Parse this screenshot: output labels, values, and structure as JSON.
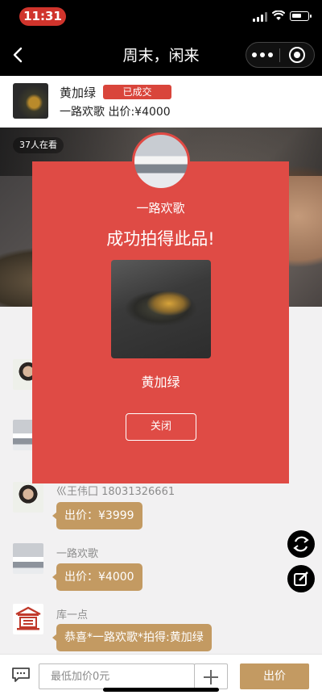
{
  "status_bar": {
    "time": "11:31"
  },
  "nav": {
    "title": "周末，闲来"
  },
  "product": {
    "name": "黄加绿",
    "status": "已成交",
    "buyer_price": "一路欢歌 出价:¥4000"
  },
  "live": {
    "viewers": "37人在看"
  },
  "chat": {
    "messages": [
      {
        "name": "巛王伟囗 18031326661",
        "text": "出价：¥3999"
      },
      {
        "name": "一路欢歌",
        "text": "出价：¥4000"
      },
      {
        "name": "库一点",
        "text": "恭喜*一路欢歌*拍得:黄加绿"
      }
    ]
  },
  "bottom": {
    "bid_placeholder": "最低加价0元",
    "bid_button": "出价"
  },
  "modal": {
    "user": "一路欢歌",
    "headline": "成功拍得此品!",
    "item": "黄加绿",
    "close": "关闭"
  },
  "colors": {
    "accent_red": "#df4b45",
    "bubble_gold": "#c39a62"
  }
}
